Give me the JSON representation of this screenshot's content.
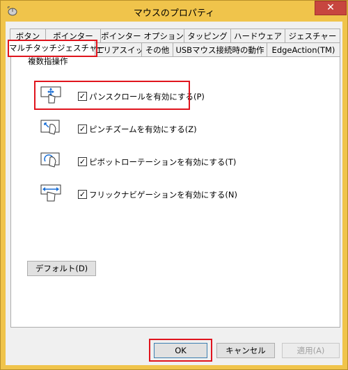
{
  "window": {
    "title": "マウスのプロパティ",
    "close_glyph": "✕"
  },
  "tabs_row1": [
    "ボタン",
    "ポインター",
    "ポインター オプション",
    "タッピング",
    "ハードウェア",
    "ジェスチャー"
  ],
  "tabs_row2": [
    "マルチタッチジェスチャー",
    "エリアスイッチ",
    "その他",
    "USBマウス接続時の動作",
    "EdgeAction(TM)"
  ],
  "active_tab": "マルチタッチジェスチャー",
  "group": {
    "label": "複数指操作",
    "items": [
      {
        "label": "パンスクロールを有効にする(P)",
        "checked": true,
        "icon": "pan-scroll-gesture-icon"
      },
      {
        "label": "ピンチズームを有効にする(Z)",
        "checked": true,
        "icon": "pinch-zoom-gesture-icon"
      },
      {
        "label": "ピボットローテーションを有効にする(T)",
        "checked": true,
        "icon": "pivot-rotation-gesture-icon"
      },
      {
        "label": "フリックナビゲーションを有効にする(N)",
        "checked": true,
        "icon": "flick-navigation-gesture-icon"
      }
    ]
  },
  "buttons": {
    "default": "デフォルト(D)",
    "ok": "OK",
    "cancel": "キャンセル",
    "apply": "適用(A)"
  },
  "colors": {
    "window_frame": "#f0c44b",
    "highlight": "#e0141d",
    "close_button": "#c7463f"
  }
}
